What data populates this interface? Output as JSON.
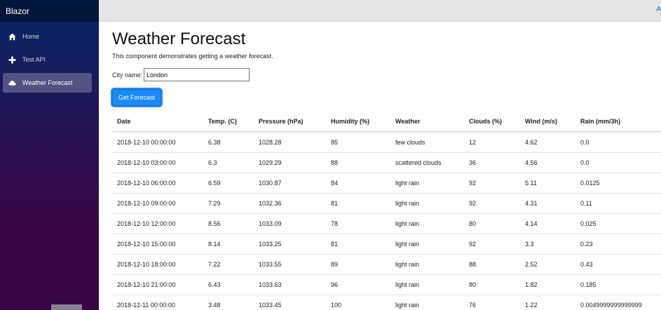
{
  "sidebar": {
    "brand": "Blazor",
    "items": [
      {
        "label": "Home",
        "icon": "home-icon"
      },
      {
        "label": "Test API",
        "icon": "plus-icon"
      },
      {
        "label": "Weather Forecast",
        "icon": "cloud-icon",
        "active": true
      }
    ]
  },
  "topbar": {
    "link": "A"
  },
  "main": {
    "title": "Weather Forecast",
    "description": "This component demonstrates getting a weather forecast.",
    "city_label": "City name:",
    "city_value": "London",
    "button_label": "Get Forecast"
  },
  "table": {
    "headers": [
      "Date",
      "Temp. (C)",
      "Pressure (hPa)",
      "Humidity (%)",
      "Weather",
      "Clouds (%)",
      "Wind (m/s)",
      "Rain (mm/3h)"
    ],
    "rows": [
      [
        "2018-12-10 00:00:00",
        "6.38",
        "1028.28",
        "85",
        "few clouds",
        "12",
        "4.62",
        "0.0"
      ],
      [
        "2018-12-10 03:00:00",
        "6.3",
        "1029.29",
        "88",
        "scattered clouds",
        "36",
        "4.56",
        "0.0"
      ],
      [
        "2018-12-10 06:00:00",
        "6.59",
        "1030.87",
        "84",
        "light rain",
        "92",
        "5.11",
        "0.0125"
      ],
      [
        "2018-12-10 09:00:00",
        "7.29",
        "1032.36",
        "81",
        "light rain",
        "92",
        "4.31",
        "0.11"
      ],
      [
        "2018-12-10 12:00:00",
        "8.56",
        "1033.09",
        "78",
        "light rain",
        "80",
        "4.14",
        "0.025"
      ],
      [
        "2018-12-10 15:00:00",
        "8.14",
        "1033.25",
        "81",
        "light rain",
        "92",
        "3.3",
        "0.23"
      ],
      [
        "2018-12-10 18:00:00",
        "7.22",
        "1033.55",
        "89",
        "light rain",
        "88",
        "2.52",
        "0.43"
      ],
      [
        "2018-12-10 21:00:00",
        "6.43",
        "1033.63",
        "96",
        "light rain",
        "80",
        "1.82",
        "0.185"
      ],
      [
        "2018-12-11 00:00:00",
        "3.48",
        "1033.45",
        "100",
        "light rain",
        "76",
        "1.22",
        "0.0049999999999999"
      ]
    ]
  }
}
